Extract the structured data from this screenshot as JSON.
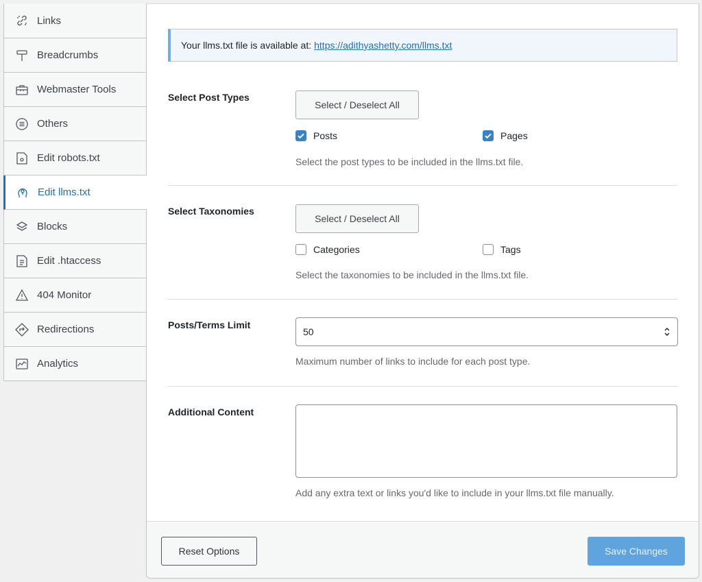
{
  "sidebar": {
    "items": [
      {
        "label": "Links",
        "icon": "links-icon"
      },
      {
        "label": "Breadcrumbs",
        "icon": "signpost-icon"
      },
      {
        "label": "Webmaster Tools",
        "icon": "toolbox-icon"
      },
      {
        "label": "Others",
        "icon": "list-circle-icon"
      },
      {
        "label": "Edit robots.txt",
        "icon": "robot-file-icon"
      },
      {
        "label": "Edit llms.txt",
        "icon": "ai-head-icon",
        "active": true
      },
      {
        "label": "Blocks",
        "icon": "blocks-icon"
      },
      {
        "label": "Edit .htaccess",
        "icon": "file-lines-icon"
      },
      {
        "label": "404 Monitor",
        "icon": "warning-icon"
      },
      {
        "label": "Redirections",
        "icon": "redirect-icon"
      },
      {
        "label": "Analytics",
        "icon": "chart-icon"
      }
    ]
  },
  "notice": {
    "text": "Your llms.txt file is available at:",
    "link": "https://adithyashetty.com/llms.txt"
  },
  "post_types": {
    "label": "Select Post Types",
    "button": "Select / Deselect All",
    "options": [
      {
        "label": "Posts",
        "checked": true
      },
      {
        "label": "Pages",
        "checked": true
      }
    ],
    "description": "Select the post types to be included in the llms.txt file."
  },
  "taxonomies": {
    "label": "Select Taxonomies",
    "button": "Select / Deselect All",
    "options": [
      {
        "label": "Categories",
        "checked": false
      },
      {
        "label": "Tags",
        "checked": false
      }
    ],
    "description": "Select the taxonomies to be included in the llms.txt file."
  },
  "limit": {
    "label": "Posts/Terms Limit",
    "value": "50",
    "description": "Maximum number of links to include for each post type."
  },
  "additional": {
    "label": "Additional Content",
    "value": "",
    "description": "Add any extra text or links you'd like to include in your llms.txt file manually."
  },
  "footer": {
    "reset_label": "Reset Options",
    "save_label": "Save Changes"
  },
  "colors": {
    "accent": "#2271b1",
    "checkbox": "#3582c4",
    "save_button": "#5fa3df"
  }
}
